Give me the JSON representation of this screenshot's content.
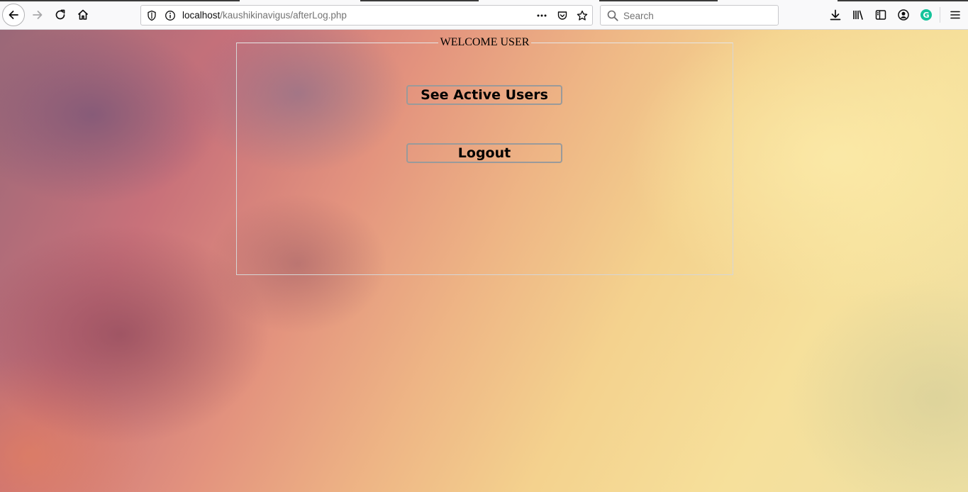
{
  "browser": {
    "url_host": "localhost",
    "url_path": "/kaushikinavigus/afterLog.php",
    "search_placeholder": "Search",
    "icons": [
      "back-arrow-icon",
      "forward-arrow-icon",
      "reload-icon",
      "home-icon",
      "shield-icon",
      "info-icon",
      "more-dots-icon",
      "pocket-icon",
      "star-icon",
      "search-icon",
      "download-icon",
      "library-icon",
      "sidebar-icon",
      "account-icon",
      "grammarly-icon",
      "menu-icon"
    ],
    "grammarly_letter": "G"
  },
  "page": {
    "fieldset_legend": "WELCOME USER",
    "buttons": {
      "active_users": "See Active Users",
      "logout": "Logout"
    }
  },
  "colors": {
    "chrome_bg": "#f9f9fa",
    "grammarly": "#15c39a",
    "fieldset_border": "#d6d6d6"
  }
}
